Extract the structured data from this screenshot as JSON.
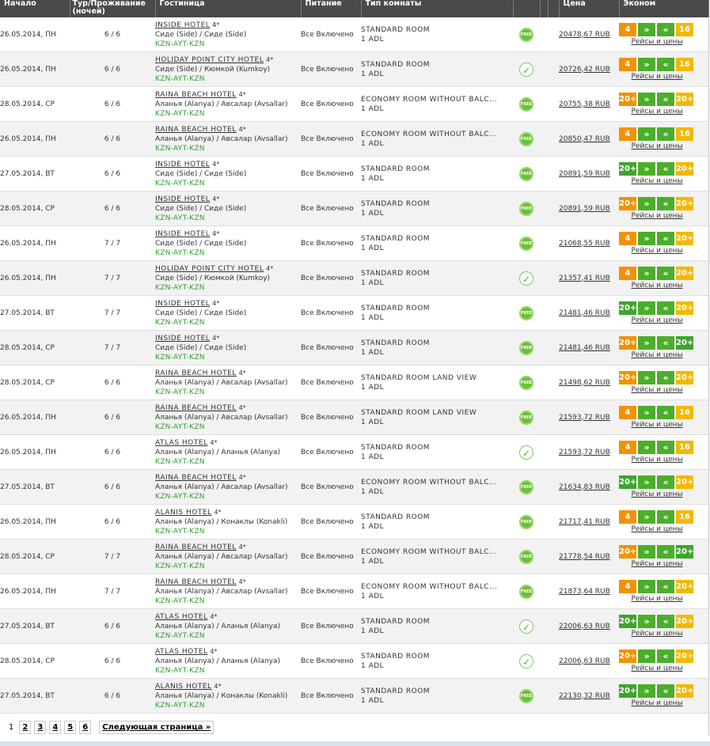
{
  "header": {
    "start": "Начало",
    "nights": "Тур/Проживание (ночей)",
    "hotel": "Гостиница",
    "board": "Питание",
    "room": "Тип комнаты",
    "price": "Цена",
    "econom": "Эконом"
  },
  "flights_link_label": "Рейсы и цены",
  "badge_labels": {
    "free": "FREE",
    "ok": "✓"
  },
  "colors": {
    "orange": "#f39200",
    "green": "#3ea52e",
    "yellow": "#f4b800",
    "route": "#2f9e2f",
    "header": "#4a4a4a"
  },
  "rows": [
    {
      "date": "26.05.2014, ПН",
      "nights": "6 / 6",
      "hotel": "INSIDE HOTEL",
      "stars": "4*",
      "location": "Сиде (Side) / Сиде (Side)",
      "route": "KZN-AYT-KZN",
      "board": "Все Включено",
      "room": "STANDARD ROOM",
      "pax": "1 ADL",
      "badge": "free",
      "price": "20478,67 RUB",
      "out": {
        "v": "4",
        "c": "orange"
      },
      "ret": {
        "v": "16",
        "c": "yellow"
      }
    },
    {
      "date": "26.05.2014, ПН",
      "nights": "6 / 6",
      "hotel": "HOLIDAY POINT CITY HOTEL",
      "stars": "4*",
      "location": "Сиде (Side) / Кюмкой (Kumkoy)",
      "route": "KZN-AYT-KZN",
      "board": "Все Включено",
      "room": "STANDARD ROOM",
      "pax": "1 ADL",
      "badge": "ok",
      "price": "20726,42 RUB",
      "out": {
        "v": "4",
        "c": "orange"
      },
      "ret": {
        "v": "16",
        "c": "yellow"
      }
    },
    {
      "date": "28.05.2014, СР",
      "nights": "6 / 6",
      "hotel": "RAINA BEACH HOTEL",
      "stars": "4*",
      "location": "Аланья (Alanya) / Авсалар (Avsallar)",
      "route": "KZN-AYT-KZN",
      "board": "Все Включено",
      "room": "ECONOMY ROOM WITHOUT BALC...",
      "pax": "1 ADL",
      "badge": "free",
      "price": "20755,38 RUB",
      "out": {
        "v": "20+",
        "c": "orange"
      },
      "ret": {
        "v": "20+",
        "c": "yellow"
      }
    },
    {
      "date": "26.05.2014, ПН",
      "nights": "6 / 6",
      "hotel": "RAINA BEACH HOTEL",
      "stars": "4*",
      "location": "Аланья (Alanya) / Авсалар (Avsallar)",
      "route": "KZN-AYT-KZN",
      "board": "Все Включено",
      "room": "ECONOMY ROOM WITHOUT BALC...",
      "pax": "1 ADL",
      "badge": "free",
      "price": "20850,47 RUB",
      "out": {
        "v": "4",
        "c": "orange"
      },
      "ret": {
        "v": "16",
        "c": "yellow"
      }
    },
    {
      "date": "27.05.2014, ВТ",
      "nights": "6 / 6",
      "hotel": "INSIDE HOTEL",
      "stars": "4*",
      "location": "Сиде (Side) / Сиде (Side)",
      "route": "KZN-AYT-KZN",
      "board": "Все Включено",
      "room": "STANDARD ROOM",
      "pax": "1 ADL",
      "badge": "free",
      "price": "20891,59 RUB",
      "out": {
        "v": "20+",
        "c": "green"
      },
      "ret": {
        "v": "20+",
        "c": "yellow"
      }
    },
    {
      "date": "28.05.2014, СР",
      "nights": "6 / 6",
      "hotel": "INSIDE HOTEL",
      "stars": "4*",
      "location": "Сиде (Side) / Сиде (Side)",
      "route": "KZN-AYT-KZN",
      "board": "Все Включено",
      "room": "STANDARD ROOM",
      "pax": "1 ADL",
      "badge": "free",
      "price": "20891,59 RUB",
      "out": {
        "v": "20+",
        "c": "orange"
      },
      "ret": {
        "v": "20+",
        "c": "yellow"
      }
    },
    {
      "date": "26.05.2014, ПН",
      "nights": "7 / 7",
      "hotel": "INSIDE HOTEL",
      "stars": "4*",
      "location": "Сиде (Side) / Сиде (Side)",
      "route": "KZN-AYT-KZN",
      "board": "Все Включено",
      "room": "STANDARD ROOM",
      "pax": "1 ADL",
      "badge": "free",
      "price": "21068,55 RUB",
      "out": {
        "v": "4",
        "c": "orange"
      },
      "ret": {
        "v": "20+",
        "c": "yellow"
      }
    },
    {
      "date": "26.05.2014, ПН",
      "nights": "7 / 7",
      "hotel": "HOLIDAY POINT CITY HOTEL",
      "stars": "4*",
      "location": "Сиде (Side) / Кюмкой (Kumkoy)",
      "route": "KZN-AYT-KZN",
      "board": "Все Включено",
      "room": "STANDARD ROOM",
      "pax": "1 ADL",
      "badge": "ok",
      "price": "21357,41 RUB",
      "out": {
        "v": "4",
        "c": "orange"
      },
      "ret": {
        "v": "20+",
        "c": "yellow"
      }
    },
    {
      "date": "27.05.2014, ВТ",
      "nights": "7 / 7",
      "hotel": "INSIDE HOTEL",
      "stars": "4*",
      "location": "Сиде (Side) / Сиде (Side)",
      "route": "KZN-AYT-KZN",
      "board": "Все Включено",
      "room": "STANDARD ROOM",
      "pax": "1 ADL",
      "badge": "free",
      "price": "21481,46 RUB",
      "out": {
        "v": "20+",
        "c": "green"
      },
      "ret": {
        "v": "20+",
        "c": "yellow"
      }
    },
    {
      "date": "28.05.2014, СР",
      "nights": "7 / 7",
      "hotel": "INSIDE HOTEL",
      "stars": "4*",
      "location": "Сиде (Side) / Сиде (Side)",
      "route": "KZN-AYT-KZN",
      "board": "Все Включено",
      "room": "STANDARD ROOM",
      "pax": "1 ADL",
      "badge": "free",
      "price": "21481,46 RUB",
      "out": {
        "v": "20+",
        "c": "orange"
      },
      "ret": {
        "v": "20+",
        "c": "green"
      }
    },
    {
      "date": "28.05.2014, СР",
      "nights": "6 / 6",
      "hotel": "RAINA BEACH HOTEL",
      "stars": "4*",
      "location": "Аланья (Alanya) / Авсалар (Avsallar)",
      "route": "KZN-AYT-KZN",
      "board": "Все Включено",
      "room": "STANDARD ROOM LAND VIEW",
      "pax": "1 ADL",
      "badge": "free",
      "price": "21498,62 RUB",
      "out": {
        "v": "20+",
        "c": "orange"
      },
      "ret": {
        "v": "20+",
        "c": "yellow"
      }
    },
    {
      "date": "26.05.2014, ПН",
      "nights": "6 / 6",
      "hotel": "RAINA BEACH HOTEL",
      "stars": "4*",
      "location": "Аланья (Alanya) / Авсалар (Avsallar)",
      "route": "KZN-AYT-KZN",
      "board": "Все Включено",
      "room": "STANDARD ROOM LAND VIEW",
      "pax": "1 ADL",
      "badge": "free",
      "price": "21593,72 RUB",
      "out": {
        "v": "4",
        "c": "orange"
      },
      "ret": {
        "v": "16",
        "c": "yellow"
      }
    },
    {
      "date": "26.05.2014, ПН",
      "nights": "6 / 6",
      "hotel": "ATLAS HOTEL",
      "stars": "4*",
      "location": "Аланья (Alanya) / Аланья (Alanya)",
      "route": "KZN-AYT-KZN",
      "board": "Все Включено",
      "room": "STANDARD ROOM",
      "pax": "1 ADL",
      "badge": "ok",
      "price": "21593,72 RUB",
      "out": {
        "v": "4",
        "c": "orange"
      },
      "ret": {
        "v": "16",
        "c": "yellow"
      }
    },
    {
      "date": "27.05.2014, ВТ",
      "nights": "6 / 6",
      "hotel": "RAINA BEACH HOTEL",
      "stars": "4*",
      "location": "Аланья (Alanya) / Авсалар (Avsallar)",
      "route": "KZN-AYT-KZN",
      "board": "Все Включено",
      "room": "ECONOMY ROOM WITHOUT BALC...",
      "pax": "1 ADL",
      "badge": "free",
      "price": "21634,83 RUB",
      "out": {
        "v": "20+",
        "c": "green"
      },
      "ret": {
        "v": "20+",
        "c": "yellow"
      }
    },
    {
      "date": "26.05.2014, ПН",
      "nights": "6 / 6",
      "hotel": "ALANIS HOTEL",
      "stars": "4*",
      "location": "Аланья (Alanya) / Конаклы (Konakli)",
      "route": "KZN-AYT-KZN",
      "board": "Все Включено",
      "room": "STANDARD ROOM",
      "pax": "1 ADL",
      "badge": "free",
      "price": "21717,41 RUB",
      "out": {
        "v": "4",
        "c": "orange"
      },
      "ret": {
        "v": "16",
        "c": "yellow"
      }
    },
    {
      "date": "28.05.2014, СР",
      "nights": "7 / 7",
      "hotel": "RAINA BEACH HOTEL",
      "stars": "4*",
      "location": "Аланья (Alanya) / Авсалар (Avsallar)",
      "route": "KZN-AYT-KZN",
      "board": "Все Включено",
      "room": "ECONOMY ROOM WITHOUT BALC...",
      "pax": "1 ADL",
      "badge": "free",
      "price": "21778,54 RUB",
      "out": {
        "v": "20+",
        "c": "orange"
      },
      "ret": {
        "v": "20+",
        "c": "green"
      }
    },
    {
      "date": "26.05.2014, ПН",
      "nights": "7 / 7",
      "hotel": "RAINA BEACH HOTEL",
      "stars": "4*",
      "location": "Аланья (Alanya) / Авсалар (Avsallar)",
      "route": "KZN-AYT-KZN",
      "board": "Все Включено",
      "room": "ECONOMY ROOM WITHOUT BALC...",
      "pax": "1 ADL",
      "badge": "free",
      "price": "21873,64 RUB",
      "out": {
        "v": "4",
        "c": "orange"
      },
      "ret": {
        "v": "20+",
        "c": "yellow"
      }
    },
    {
      "date": "27.05.2014, ВТ",
      "nights": "6 / 6",
      "hotel": "ATLAS HOTEL",
      "stars": "4*",
      "location": "Аланья (Alanya) / Аланья (Alanya)",
      "route": "KZN-AYT-KZN",
      "board": "Все Включено",
      "room": "STANDARD ROOM",
      "pax": "1 ADL",
      "badge": "ok",
      "price": "22006,63 RUB",
      "out": {
        "v": "20+",
        "c": "green"
      },
      "ret": {
        "v": "20+",
        "c": "yellow"
      }
    },
    {
      "date": "28.05.2014, СР",
      "nights": "6 / 6",
      "hotel": "ATLAS HOTEL",
      "stars": "4*",
      "location": "Аланья (Alanya) / Аланья (Alanya)",
      "route": "KZN-AYT-KZN",
      "board": "Все Включено",
      "room": "STANDARD ROOM",
      "pax": "1 ADL",
      "badge": "ok",
      "price": "22006,63 RUB",
      "out": {
        "v": "20+",
        "c": "orange"
      },
      "ret": {
        "v": "20+",
        "c": "yellow"
      }
    },
    {
      "date": "27.05.2014, ВТ",
      "nights": "6 / 6",
      "hotel": "ALANIS HOTEL",
      "stars": "4*",
      "location": "Аланья (Alanya) / Конаклы (Konakli)",
      "route": "KZN-AYT-KZN",
      "board": "Все Включено",
      "room": "STANDARD ROOM",
      "pax": "1 ADL",
      "badge": "free",
      "price": "22130,32 RUB",
      "out": {
        "v": "20+",
        "c": "green"
      },
      "ret": {
        "v": "20+",
        "c": "yellow"
      }
    }
  ],
  "pagination": {
    "current": "1",
    "pages": [
      "2",
      "3",
      "4",
      "5",
      "6"
    ],
    "next_label": "Следующая страница »"
  }
}
